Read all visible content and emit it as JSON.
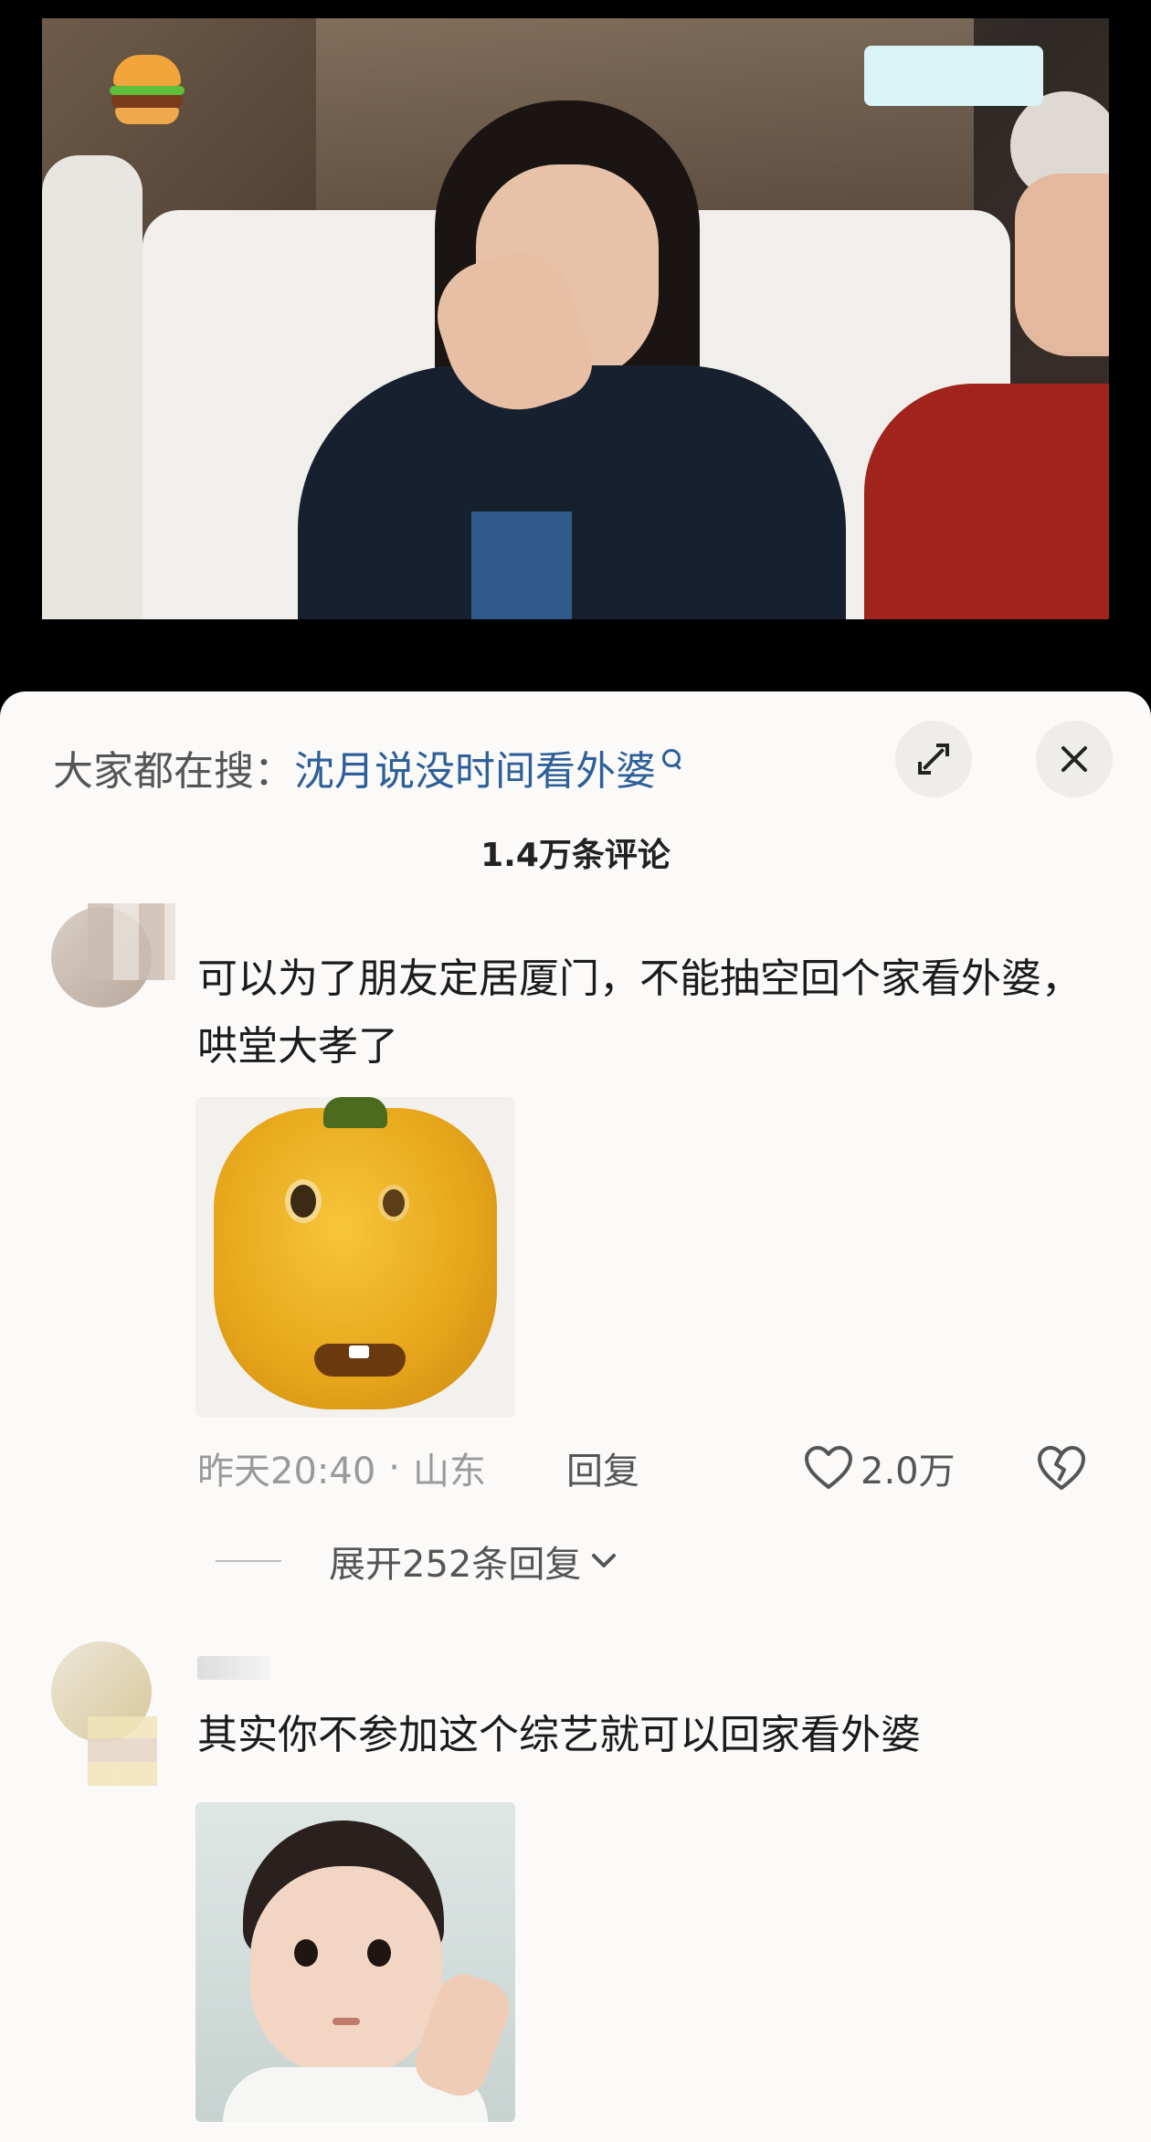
{
  "search": {
    "prefix": "大家都在搜：",
    "term": "沈月说没时间看外婆"
  },
  "header": {
    "comment_count": "1.4万条评论"
  },
  "comments": [
    {
      "text": "可以为了朋友定居厦门，不能抽空回个家看外婆，哄堂大孝了",
      "time": "昨天20:40",
      "dot": "·",
      "location": "山东",
      "reply_label": "回复",
      "likes": "2.0万",
      "expand_replies": "展开252条回复"
    },
    {
      "text": "其实你不参加这个综艺就可以回家看外婆"
    }
  ],
  "icons": {
    "expand": "expand-icon",
    "close": "close-icon",
    "search": "search-icon",
    "like": "heart-icon",
    "dislike": "broken-heart-icon",
    "chevron": "chevron-down-icon"
  },
  "colors": {
    "search_term": "#2d5f9a",
    "sheet_bg": "#fbfaf8"
  }
}
